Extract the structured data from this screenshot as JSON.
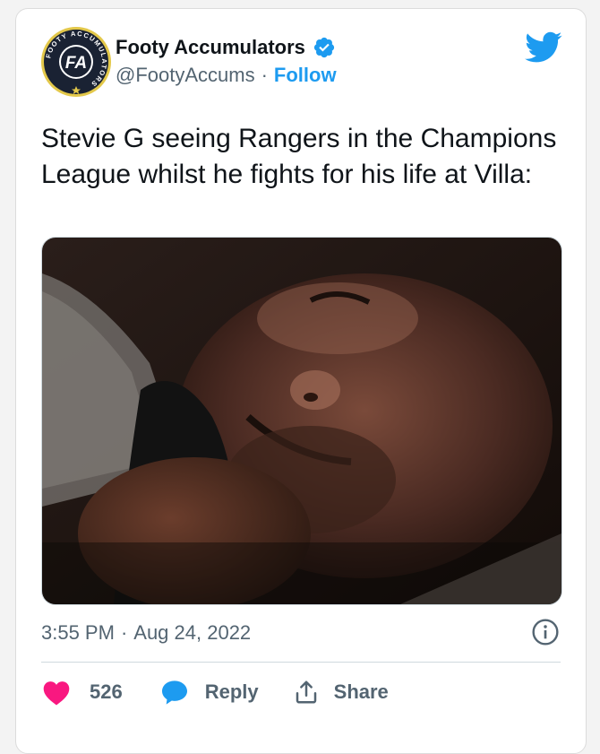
{
  "tweet": {
    "author_name": "Footy Accumulators",
    "handle": "@FootyAccums",
    "separator": "·",
    "follow_label": "Follow",
    "text": "Stevie G seeing Rangers in the Champions League whilst he fights for his life at Villa:",
    "time": "3:55 PM",
    "date": "Aug 24, 2022",
    "verified": true,
    "media_description": "video still of a man lying down grimacing"
  },
  "avatar": {
    "ring_text": "FOOTY ACCUMULATORS",
    "monogram": "FA"
  },
  "actions": {
    "like_count": "526",
    "reply_label": "Reply",
    "share_label": "Share"
  },
  "icons": {
    "brand": "twitter-bird-icon",
    "verified": "verified-badge-icon",
    "info": "info-icon",
    "like": "heart-icon",
    "reply": "speech-bubble-icon",
    "share": "share-icon"
  },
  "colors": {
    "twitter_blue": "#1d9bf0",
    "heart_red": "#f91880",
    "text": "#0f1419",
    "secondary_text": "#536471",
    "avatar_dark": "#1a2233",
    "avatar_gold": "#e3c84a"
  }
}
